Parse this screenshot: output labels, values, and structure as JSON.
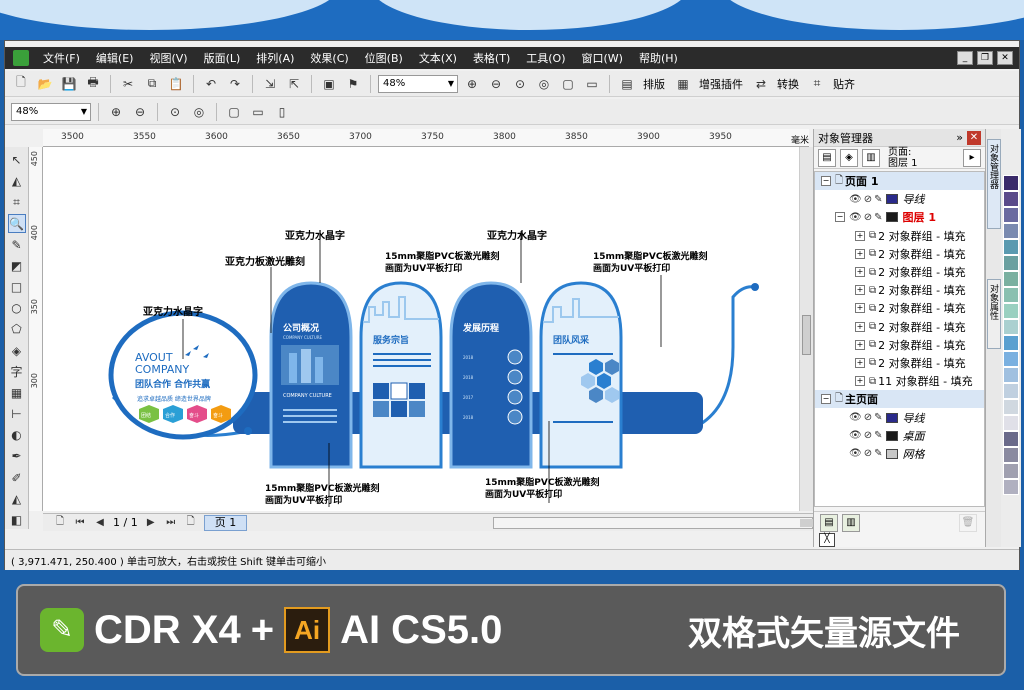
{
  "menu": {
    "items": [
      "文件(F)",
      "编辑(E)",
      "视图(V)",
      "版面(L)",
      "排列(A)",
      "效果(C)",
      "位图(B)",
      "文本(X)",
      "表格(T)",
      "工具(O)",
      "窗口(W)",
      "帮助(H)"
    ]
  },
  "toolbar": {
    "zoom_value": "48%",
    "zoom_value_2": "48%",
    "layout_label": "排版",
    "plugin_label": "增强插件",
    "convert_label": "转换",
    "paste_label": "贴齐"
  },
  "ruler": {
    "h_ticks": [
      "3500",
      "3550",
      "3600",
      "3650",
      "3700",
      "3750",
      "3800",
      "3850",
      "3900",
      "3950"
    ],
    "v_ticks": [
      "450",
      "400",
      "350",
      "300"
    ],
    "unit": "毫米"
  },
  "canvas": {
    "labels": {
      "acrylic_crystal_1": "亚克力水晶字",
      "acrylic_crystal_2": "亚克力水晶字",
      "acrylic_crystal_3": "亚克力水晶字",
      "acrylic_laser": "亚克力板激光雕刻",
      "pvc_top_1": "15mm聚脂PVC板激光雕刻",
      "pvc_top_2": "画面为UV平板打印",
      "pvc_top_3": "15mm聚脂PVC板激光雕刻",
      "pvc_top_4": "画面为UV平板打印",
      "pvc_bottom_1": "15mm聚脂PVC板激光雕刻",
      "pvc_bottom_2": "画面为UV平板打印",
      "pvc_bottom_3": "15mm聚脂PVC板激光雕刻",
      "pvc_bottom_4": "画面为UV平板打印"
    },
    "panel": {
      "avout": "AVOUT",
      "company": "COMPANY",
      "slogan": "团队合作 合作共赢",
      "sub_slogan": "追求卓越品质 缔造世界品牌",
      "hexes": [
        "团结",
        "合作",
        "奋斗",
        "奋斗"
      ],
      "section_1": "公司概况",
      "section_2": "服务宗旨",
      "section_3": "发展历程",
      "section_4": "团队风采",
      "culture": "COMPANY CULTURE",
      "years": [
        "2018",
        "2018",
        "2017",
        "2018"
      ]
    }
  },
  "pagebar": {
    "page_counter": "1 / 1",
    "page_tab": "页 1"
  },
  "status": {
    "text": "( 3,971.471, 250.400 ) 单击可放大，右击或按住 Shift 键单击可缩小"
  },
  "object_manager": {
    "title": "对象管理器",
    "page_label": "页面:",
    "layer_label": "图层 1",
    "rows": [
      {
        "type": "page",
        "label": "页面 1"
      },
      {
        "type": "layer",
        "label": "导线",
        "color": "#2a2a8a",
        "style": "italic"
      },
      {
        "type": "layer",
        "label": "图层 1",
        "color": "#1a1a1a",
        "style": "red"
      },
      {
        "type": "group",
        "label": "2 对象群组 - 填充"
      },
      {
        "type": "group",
        "label": "2 对象群组 - 填充"
      },
      {
        "type": "group",
        "label": "2 对象群组 - 填充"
      },
      {
        "type": "group",
        "label": "2 对象群组 - 填充"
      },
      {
        "type": "group",
        "label": "2 对象群组 - 填充"
      },
      {
        "type": "group",
        "label": "2 对象群组 - 填充"
      },
      {
        "type": "group",
        "label": "2 对象群组 - 填充"
      },
      {
        "type": "group",
        "label": "2 对象群组 - 填充"
      },
      {
        "type": "group",
        "label": "11 对象群组 - 填充"
      },
      {
        "type": "page",
        "label": "主页面"
      },
      {
        "type": "layer",
        "label": "导线",
        "color": "#2a2a8a",
        "style": "italic"
      },
      {
        "type": "layer",
        "label": "桌面",
        "color": "#1a1a1a",
        "style": "italic"
      },
      {
        "type": "layer",
        "label": "网格",
        "color": "#c8c8c8",
        "style": "italic"
      }
    ],
    "dock_tab_1": "对象管理器",
    "dock_tab_2": "对象属性"
  },
  "promo": {
    "cdr": "CDR X4",
    "plus": "+",
    "ai_logo": "Ai",
    "ai": "AI CS5.0",
    "title": "双格式矢量源文件"
  },
  "colors": {
    "brand_blue": "#1e6cc0",
    "panel_blue": "#1f5fb0",
    "light_blue": "#cfe4f7"
  }
}
